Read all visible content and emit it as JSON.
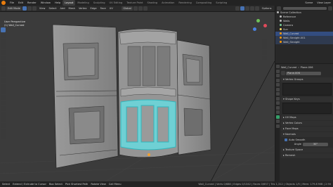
{
  "menubar": {
    "menus": [
      "File",
      "Edit",
      "Render",
      "Window",
      "Help"
    ],
    "workspaces": [
      "Layout",
      "Modeling",
      "Sculpting",
      "UV Editing",
      "Texture Paint",
      "Shading",
      "Animation",
      "Rendering",
      "Compositing",
      "Scripting"
    ],
    "active_workspace": "Layout",
    "scene": "Scene",
    "view_layer": "View Layer"
  },
  "viewport_header": {
    "mode": "Edit Mode",
    "menus": [
      "View",
      "Select",
      "Add",
      "Mesh",
      "Vertex",
      "Edge",
      "Face",
      "UV"
    ],
    "transform": "Global",
    "options": "Options"
  },
  "viewport": {
    "view_name": "User Perspective",
    "object_name": "(1) Wall_Curved"
  },
  "outliner": {
    "title": "Scene Collection",
    "items": [
      {
        "label": "Scene Collection",
        "depth": 0,
        "state": "normal"
      },
      {
        "label": "Reference",
        "depth": 1,
        "state": "normal"
      },
      {
        "label": "Walls",
        "depth": 1,
        "state": "normal"
      },
      {
        "label": "Camera",
        "depth": 1,
        "state": "normal"
      },
      {
        "label": "Sun",
        "depth": 1,
        "state": "normal"
      },
      {
        "label": "Wall_Curved",
        "depth": 1,
        "state": "selected"
      },
      {
        "label": "Wall_Straight.001",
        "depth": 1,
        "state": "highlight"
      },
      {
        "label": "Wall_Straight",
        "depth": 1,
        "state": "highlight"
      }
    ]
  },
  "properties": {
    "object": "Wall_Curved",
    "mesh_tab": "Plane.006",
    "data_field": "Plane.006",
    "panels": [
      {
        "label": "Vertex Groups",
        "open": true
      },
      {
        "label": "Shape Keys",
        "open": true
      },
      {
        "label": "UV Maps",
        "open": false
      },
      {
        "label": "Vertex Colors",
        "open": false
      },
      {
        "label": "Face Maps",
        "open": false
      },
      {
        "label": "Normals",
        "open": true
      }
    ],
    "auto_smooth_label": "Auto Smooth",
    "angle_label": "Angle",
    "angle_value": "30°",
    "texture_space": "Texture Space",
    "remesh": "Remesh"
  },
  "statusbar": {
    "left": [
      "Select",
      "Box Select",
      "Rotate View",
      "Call Menu"
    ],
    "pick_shortest": "Pick Shortest Path",
    "extend": "Extend / Extrude to Cursor",
    "stats": "Wall_Curved | Verts 0/688 | Edges 0/1342 | Faces 0/657 | Tris 1,312 | Objects 1/5 | Mem: 179.8 MiB | 2.90"
  },
  "colors": {
    "accent": "#4772b3",
    "selected_glass": "#3fc7c7",
    "wall": "#8a8a8a"
  }
}
